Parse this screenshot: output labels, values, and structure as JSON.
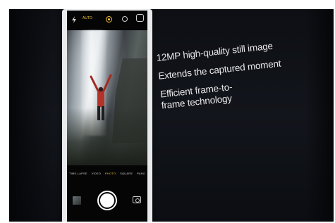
{
  "camera": {
    "flash_icon": "flash-icon",
    "flash_mode": "AUTO",
    "live_photo_icon": "live-photo-icon",
    "timer_icon": "timer-icon",
    "flip_icon": "flip-camera-icon",
    "modes": [
      "TIME-LAPSE",
      "VIDEO",
      "PHOTO",
      "SQUARE",
      "PANO"
    ],
    "active_mode": "PHOTO",
    "accent_color": "#f3c23a"
  },
  "slide": {
    "bullets": [
      "12MP high-quality still image",
      "Extends the captured moment",
      "Efficient frame-to-frame technology"
    ]
  }
}
